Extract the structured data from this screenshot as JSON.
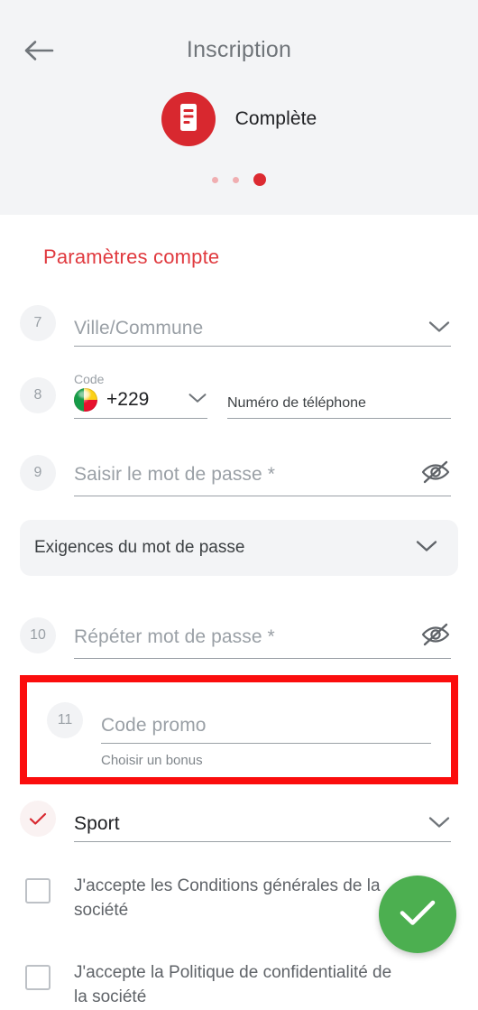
{
  "header": {
    "back_icon": "arrow-left-icon",
    "title": "Inscription",
    "step": {
      "icon": "document-form-icon",
      "label": "Complète"
    },
    "pagination": {
      "total": 3,
      "active_index": 2
    }
  },
  "form": {
    "section_title": "Paramètres compte",
    "fields": {
      "city": {
        "number": "7",
        "placeholder": "Ville/Commune",
        "value": "",
        "chevron_icon": "chevron-down-icon"
      },
      "phone": {
        "number": "8",
        "code_label": "Code",
        "flag_icon": "benin-flag-icon",
        "country_code": "+229",
        "chevron_icon": "chevron-down-icon",
        "placeholder": "Numéro de téléphone",
        "value": ""
      },
      "password": {
        "number": "9",
        "placeholder": "Saisir le mot de passe *",
        "value": "",
        "toggle_icon": "eye-off-icon"
      },
      "requirements": {
        "label": "Exigences du mot de passe",
        "chevron_icon": "chevron-down-icon"
      },
      "password_repeat": {
        "number": "10",
        "placeholder": "Répéter mot de passe *",
        "value": "",
        "toggle_icon": "eye-off-icon"
      },
      "promo": {
        "number": "11",
        "placeholder": "Code promo",
        "value": "",
        "sub_label": "Choisir un bonus",
        "highlight_color": "#fb0d0d"
      },
      "bonus": {
        "check_icon": "check-icon",
        "value": "Sport",
        "chevron_icon": "chevron-down-icon"
      }
    },
    "checkboxes": [
      {
        "checked": false,
        "label": "J'accepte les Conditions générales de la société"
      },
      {
        "checked": false,
        "label": "J'accepte la Politique de confidentialité de la société"
      }
    ]
  },
  "fab": {
    "icon": "check-icon",
    "color": "#4caf50"
  },
  "colors": {
    "brand_red": "#d8282f",
    "accent_red": "#e03a3f",
    "header_bg": "#f3f4f6",
    "green": "#4caf50",
    "highlight": "#fb0d0d"
  }
}
